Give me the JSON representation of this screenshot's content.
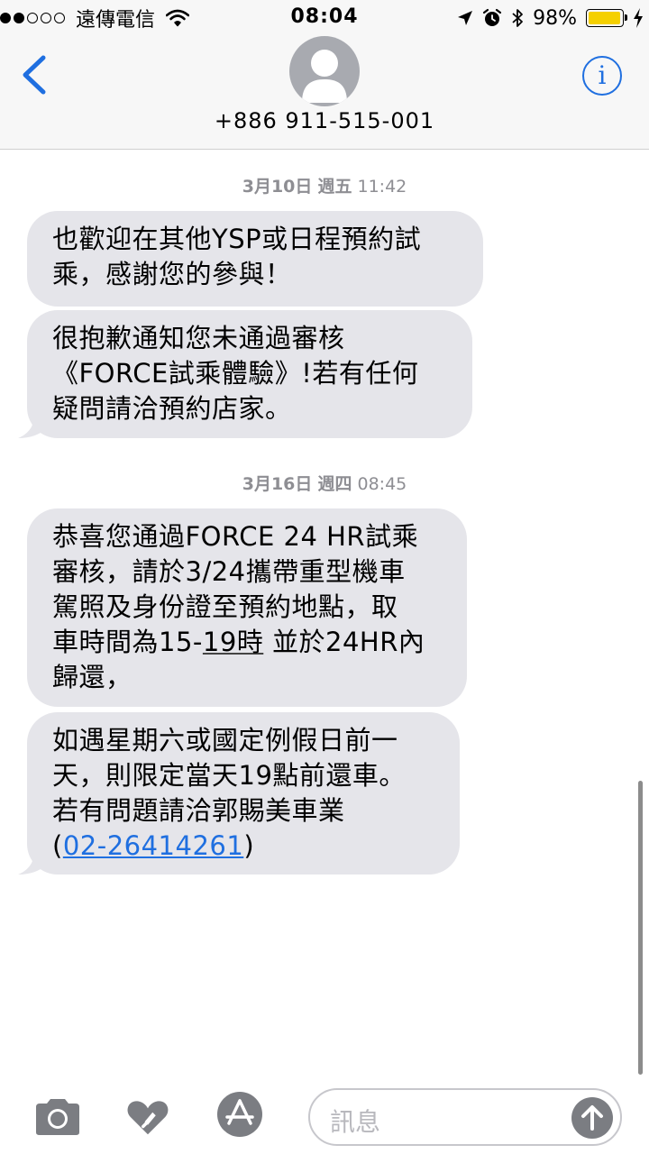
{
  "status_bar": {
    "carrier": "遠傳電信",
    "time": "08:04",
    "battery_text": "98%",
    "battery_level": 0.98,
    "signal_bars": 2,
    "signal_total": 5,
    "icons": [
      "wifi-icon",
      "location-arrow-icon",
      "alarm-clock-icon",
      "bluetooth-icon",
      "battery-icon",
      "charging-bolt-icon"
    ]
  },
  "header": {
    "contact_number": "+886 911-515-001",
    "back_icon": "chevron-left-icon",
    "info_label": "i",
    "avatar_icon": "person-silhouette-icon"
  },
  "conversation": {
    "groups": [
      {
        "date": "3月10日",
        "weekday": "週五",
        "time": "11:42",
        "messages": [
          [
            "也歡迎在其他YSP或日程預約試",
            "乘，感謝您的參與！"
          ],
          [
            "很抱歉通知您未通過審核",
            "《FORCE試乘體驗》!若有任何",
            "疑問請洽預約店家。"
          ]
        ]
      },
      {
        "date": "3月16日",
        "weekday": "週四",
        "time": "08:45",
        "messages": [
          [
            "恭喜您通過FORCE 24 HR試乘",
            "審核，請於3/24攜帶重型機車",
            "駕照及身份證至預約地點，取"
          ],
          [
            "如遇星期六或國定例假日前一",
            "天，則限定當天19點前還車。",
            "若有問題請洽郭賜美車業"
          ]
        ],
        "msg1_line4": {
          "pre": "車時間為15-",
          "underlined": "19時",
          "post": " 並於24HR內"
        },
        "msg1_line5": "歸還，",
        "msg2_line4": {
          "open": "(",
          "phone": "02-26414261",
          "close": ")"
        }
      }
    ]
  },
  "composer": {
    "placeholder": "訊息",
    "camera_icon": "camera-icon",
    "digital_touch_icon": "digital-touch-heart-icon",
    "app_store_icon": "app-store-icon",
    "send_icon": "send-arrow-up-icon"
  },
  "colors": {
    "accent": "#1f6fe0",
    "bubble_gray": "#e5e5ea",
    "timestamp_gray": "#8e8e93",
    "battery_yellow": "#f5d000"
  }
}
